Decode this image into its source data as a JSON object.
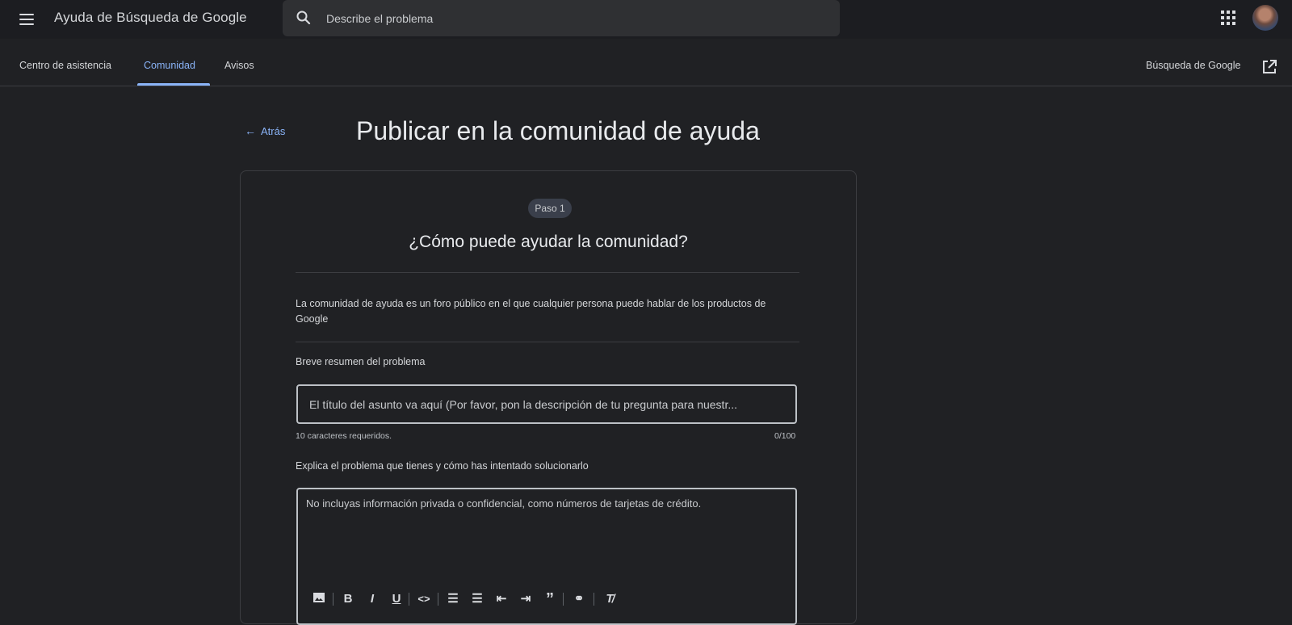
{
  "header": {
    "app_title": "Ayuda de Búsqueda de Google",
    "search_placeholder": "Describe el problema",
    "menu_icon": "hamburger-menu-icon",
    "apps_icon": "apps-grid-icon"
  },
  "nav": {
    "tabs": [
      {
        "label": "Centro de asistencia",
        "active": false
      },
      {
        "label": "Comunidad",
        "active": true
      },
      {
        "label": "Avisos",
        "active": false
      }
    ],
    "external_link": "Búsqueda de Google"
  },
  "page": {
    "back_label": "Atrás",
    "title": "Publicar en la comunidad de ayuda"
  },
  "form": {
    "step_label": "Paso 1",
    "heading": "¿Cómo puede ayudar la comunidad?",
    "intro": "La comunidad de ayuda es un foro público en el que cualquier persona puede hablar de los productos de Google",
    "title_label": "Breve resumen del problema",
    "title_placeholder": "El título del asunto va aquí (Por favor, pon la descripción de tu pregunta para nuestr...",
    "title_helper": "10 caracteres requeridos.",
    "title_counter": "0/100",
    "body_label": "Explica el problema que tienes y cómo has intentado solucionarlo",
    "body_placeholder": "No incluyas información privada o confidencial, como números de tarjetas de crédito."
  },
  "colors": {
    "accent": "#8ab4f8",
    "background": "#202124",
    "topbar": "#1c1d21"
  }
}
